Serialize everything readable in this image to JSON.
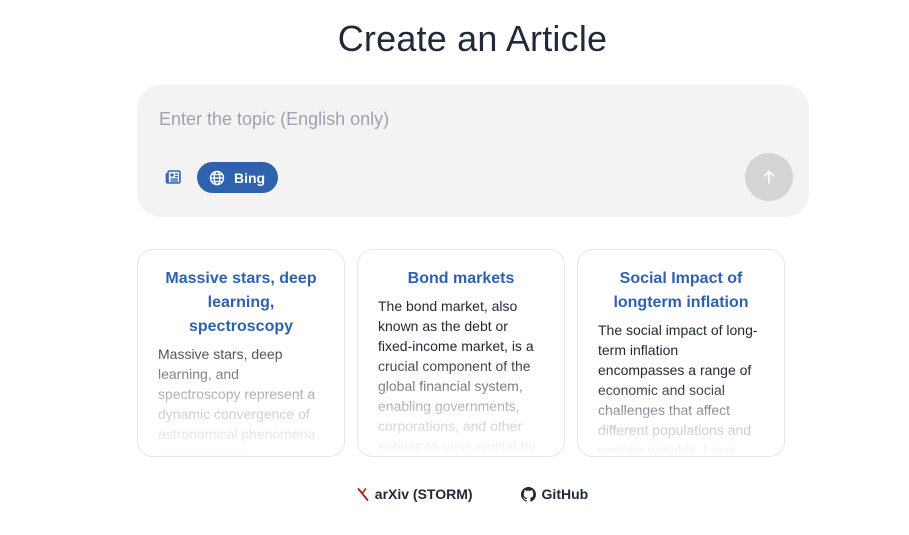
{
  "page": {
    "title": "Create an Article"
  },
  "search": {
    "placeholder": "Enter the topic (English only)",
    "value": "",
    "source_label": "Bing"
  },
  "cards": [
    {
      "title": "Massive stars, deep learning, spectroscopy",
      "body": "Massive stars, deep learning, and spectroscopy represent a dynamic convergence of astronomical phenomena and advanced computational techniques"
    },
    {
      "title": "Bond markets",
      "body": "The bond market, also known as the debt or fixed-income market, is a crucial component of the global financial system, enabling governments, corporations, and other entities to raise capital by"
    },
    {
      "title": "Social Impact of longterm inflation",
      "body": "The social impact of long-term inflation encompasses a range of economic and social challenges that affect different populations and regions variably. Long-"
    }
  ],
  "footer": {
    "arxiv_label": "arXiv (STORM)",
    "github_label": "GitHub"
  },
  "colors": {
    "accent": "#2f62ad",
    "input_bg": "#f3f3f4",
    "send_button": "#d4d4d6",
    "arxiv_red": "#b31b1b"
  },
  "icons": [
    "newspaper-icon",
    "globe-icon",
    "arrow-up-icon",
    "arxiv-icon",
    "github-icon"
  ]
}
